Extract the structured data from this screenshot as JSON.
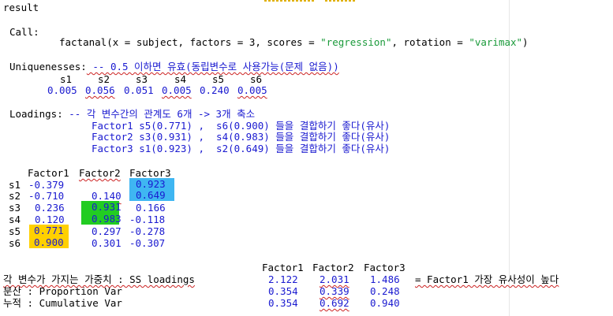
{
  "title": "result",
  "call": {
    "label": "Call:",
    "fn": "factanal",
    "args_pre": "(x = subject, factors = 3, scores = ",
    "scores": "\"regression\"",
    "args_mid": ", rotation = ",
    "rotation": "\"varimax\"",
    "args_end": ")"
  },
  "uniq": {
    "label": "Uniquenesses:",
    "comment": " -- 0.5 이하면 유효(동립변수로 사용가능(문제 없음))",
    "vars": [
      "s1",
      "s2",
      "s3",
      "s4",
      "s5",
      "s6"
    ],
    "values": [
      "0.005",
      "0.056",
      "0.051",
      "0.005",
      "0.240",
      "0.005"
    ]
  },
  "loadings": {
    "label": "Loadings:",
    "comment": " -- 각 변수간의 관계도 6개 -> 3개 축소",
    "notes": [
      "Factor1 s5(0.771) ,  s6(0.900) 들을 결합하기 좋다(유사)",
      "Factor2 s3(0.931) ,  s4(0.983) 들을 결합하기 좋다(유사)",
      "Factor3 s1(0.923) ,  s2(0.649) 들을 결합하기 좋다(유사)"
    ],
    "headers": [
      "Factor1",
      "Factor2",
      "Factor3"
    ],
    "rows": [
      {
        "name": "s1",
        "f1": "-0.379",
        "f2": "",
        "f3": "0.923"
      },
      {
        "name": "s2",
        "f1": "-0.710",
        "f2": "0.140",
        "f3": "0.649"
      },
      {
        "name": "s3",
        "f1": "0.236",
        "f2": "0.931",
        "f3": "0.166"
      },
      {
        "name": "s4",
        "f1": "0.120",
        "f2": "0.983",
        "f3": "-0.118"
      },
      {
        "name": "s5",
        "f1": "0.771",
        "f2": "0.297",
        "f3": "-0.278"
      },
      {
        "name": "s6",
        "f1": "0.900",
        "f2": "0.301",
        "f3": "-0.307"
      }
    ]
  },
  "summary": {
    "headers": [
      "Factor1",
      "Factor2",
      "Factor3"
    ],
    "rows": [
      {
        "label": "각 변수가 가지는 가중치 : SS loadings",
        "v": [
          "2.122",
          "2.031",
          "1.486"
        ],
        "tail": "= Factor1 가장 유사성이 높다"
      },
      {
        "label": "분산 : Proportion Var",
        "v": [
          "0.354",
          "0.339",
          "0.248"
        ],
        "tail": ""
      },
      {
        "label": "누적 : Cumulative Var",
        "v": [
          "0.354",
          "0.692",
          "0.940"
        ],
        "tail": ""
      }
    ]
  },
  "colors": {
    "highlight_blue": "#3fb6f2",
    "highlight_green": "#22cc22",
    "highlight_yellow": "#ffd000",
    "value_blue": "#1a1ad0",
    "string_green": "#1a9a3a"
  }
}
